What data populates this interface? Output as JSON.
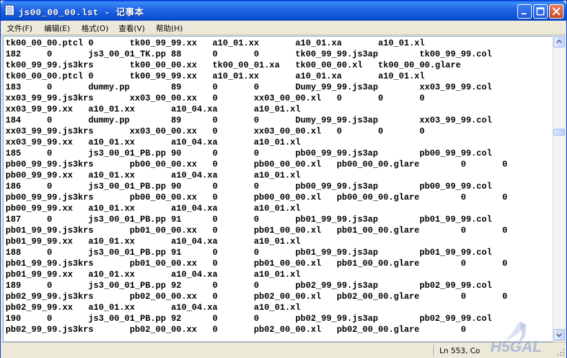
{
  "window": {
    "title": "js00_00_00.lst - 记事本"
  },
  "menu": [
    "文件(F)",
    "编辑(E)",
    "格式(O)",
    "查看(V)",
    "帮助(H)"
  ],
  "lines": [
    "tk00_00_00.ptcl 0       tk00_99_99.xx   a10_01.xx       a10_01.xa       a10_01.xl",
    "182     0       js3_00_01_TK.pp 88      0       0       tk00_99_99.js3ap        tk00_99_99.col",
    "tk00_99_99.js3krs       tk00_00_00.xx   tk00_00_01.xa   tk00_00_00.xl   tk00_00_00.glare",
    "tk00_00_00.ptcl 0       tk00_99_99.xx   a10_01.xx       a10_01.xa       a10_01.xl",
    "183     0       dummy.pp        89      0       0       Dumy_99_99.js3ap        xx03_99_99.col",
    "xx03_99_99.js3krs       xx03_00_00.xx   0       xx03_00_00.xl   0       0       0",
    "xx03_99_99.xx   a10_01.xx       a10_04.xa       a10_01.xl",
    "184     0       dummy.pp        89      0       0       Dumy_99_99.js3ap        xx03_99_99.col",
    "xx03_99_99.js3krs       xx03_00_00.xx   0       xx03_00_00.xl   0       0       0",
    "xx03_99_99.xx   a10_01.xx       a10_04.xa       a10_01.xl",
    "185     0       js3_00_01_PB.pp 90      0       0       pb00_99_99.js3ap        pb00_99_99.col",
    "pb00_99_99.js3krs       pb00_00_00.xx   0       pb00_00_00.xl   pb00_00_00.glare        0       0",
    "pb00_99_99.xx   a10_01.xx       a10_04.xa       a10_01.xl",
    "186     0       js3_00_01_PB.pp 90      0       0       pb00_99_99.js3ap        pb00_99_99.col",
    "pb00_99_99.js3krs       pb00_00_00.xx   0       pb00_00_00.xl   pb00_00_00.glare        0       0",
    "pb00_99_99.xx   a10_01.xx       a10_04.xa       a10_01.xl",
    "187     0       js3_00_01_PB.pp 91      0       0       pb01_99_99.js3ap        pb01_99_99.col",
    "pb01_99_99.js3krs       pb01_00_00.xx   0       pb01_00_00.xl   pb01_00_00.glare        0       0",
    "pb01_99_99.xx   a10_01.xx       a10_04.xa       a10_01.xl",
    "188     0       js3_00_01_PB.pp 91      0       0       pb01_99_99.js3ap        pb01_99_99.col",
    "pb01_99_99.js3krs       pb01_00_00.xx   0       pb01_00_00.xl   pb01_00_00.glare        0       0",
    "pb01_99_99.xx   a10_01.xx       a10_04.xa       a10_01.xl",
    "189     0       js3_00_01_PB.pp 92      0       0       pb02_99_99.js3ap        pb02_99_99.col",
    "pb02_99_99.js3krs       pb02_00_00.xx   0       pb02_00_00.xl   pb02_00_00.glare        0       0",
    "pb02_99_99.xx   a10_01.xx       a10_04.xa       a10_01.xl",
    "190     0       js3_00_01_PB.pp 92      0       0       pb02_99_99.js3ap        pb02_99_99.col",
    "pb02_99_99.js3krs       pb02_00_00.xx   0       pb02_00_00.xl   pb02_00_00.glare        0"
  ],
  "status": {
    "position": "Ln 553, Co"
  },
  "icons": {
    "app": "notepad-icon",
    "minimize": "minimize-icon",
    "maximize": "maximize-icon",
    "close": "close-icon",
    "scroll_up": "scroll-up-arrow-icon",
    "scroll_down": "scroll-down-arrow-icon",
    "grip": "resize-grip-icon"
  },
  "colors": {
    "titlebar": "#0a5ce0",
    "close": "#c9441d",
    "edit_bg": "#ffffff",
    "chrome": "#ece9d8"
  }
}
